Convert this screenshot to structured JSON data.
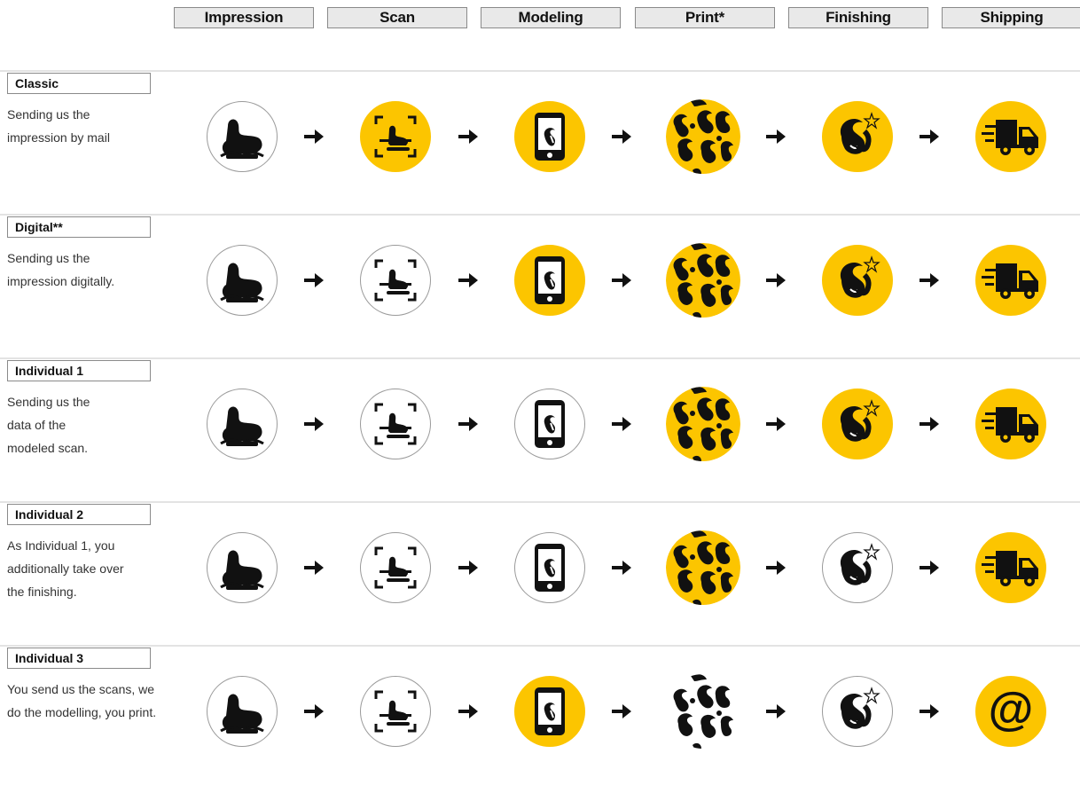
{
  "columns": [
    "Impression",
    "Scan",
    "Modeling",
    "Print*",
    "Finishing",
    "Shipping"
  ],
  "accent_color": "#fcc500",
  "rows": [
    {
      "label": "Classic",
      "desc": "Sending us the\nimpression by mail",
      "stages": [
        {
          "icon": "impression-icon",
          "active": false
        },
        {
          "icon": "scan-icon",
          "active": true
        },
        {
          "icon": "phone-model-icon",
          "active": true
        },
        {
          "icon": "print-pattern-icon",
          "active": true
        },
        {
          "icon": "finishing-icon",
          "active": true
        },
        {
          "icon": "truck-icon",
          "active": true
        }
      ]
    },
    {
      "label": "Digital**",
      "desc": "Sending us the\nimpression digitally.",
      "stages": [
        {
          "icon": "impression-icon",
          "active": false
        },
        {
          "icon": "scan-icon",
          "active": false
        },
        {
          "icon": "phone-model-icon",
          "active": true
        },
        {
          "icon": "print-pattern-icon",
          "active": true
        },
        {
          "icon": "finishing-icon",
          "active": true
        },
        {
          "icon": "truck-icon",
          "active": true
        }
      ]
    },
    {
      "label": "Individual 1",
      "desc": "Sending us the\ndata of the\nmodeled scan.",
      "stages": [
        {
          "icon": "impression-icon",
          "active": false
        },
        {
          "icon": "scan-icon",
          "active": false
        },
        {
          "icon": "phone-model-icon",
          "active": false
        },
        {
          "icon": "print-pattern-icon",
          "active": true
        },
        {
          "icon": "finishing-icon",
          "active": true
        },
        {
          "icon": "truck-icon",
          "active": true
        }
      ]
    },
    {
      "label": "Individual 2",
      "desc": "As Individual 1, you\nadditionally take over\nthe finishing.",
      "stages": [
        {
          "icon": "impression-icon",
          "active": false
        },
        {
          "icon": "scan-icon",
          "active": false
        },
        {
          "icon": "phone-model-icon",
          "active": false
        },
        {
          "icon": "print-pattern-icon",
          "active": true
        },
        {
          "icon": "finishing-icon",
          "active": false
        },
        {
          "icon": "truck-icon",
          "active": true
        }
      ]
    },
    {
      "label": "Individual 3",
      "desc": "You send us the scans, we\ndo the modelling, you print.",
      "stages": [
        {
          "icon": "impression-icon",
          "active": false
        },
        {
          "icon": "scan-icon",
          "active": false
        },
        {
          "icon": "phone-model-icon",
          "active": true
        },
        {
          "icon": "print-pattern-icon",
          "active": false
        },
        {
          "icon": "finishing-icon",
          "active": false
        },
        {
          "icon": "at-icon",
          "active": true,
          "glyph": "@"
        }
      ]
    }
  ]
}
